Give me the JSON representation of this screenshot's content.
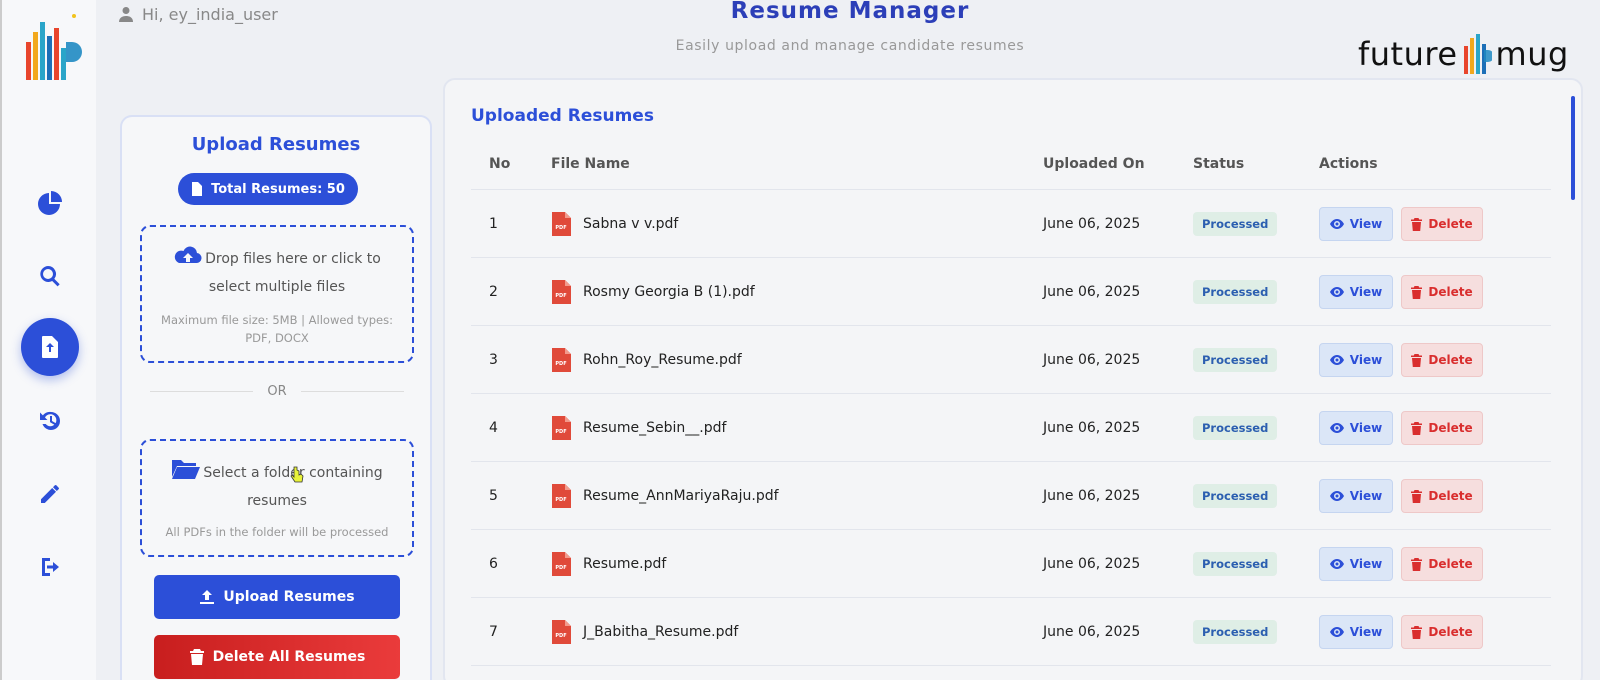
{
  "header": {
    "greeting": "Hi, ey_india_user",
    "title": "Resume Manager",
    "subtitle": "Easily upload and manage candidate resumes",
    "brand_left": "future",
    "brand_right": "mug"
  },
  "sidebar": {
    "items": [
      {
        "name": "dashboard",
        "icon": "pie-chart-icon",
        "active": false
      },
      {
        "name": "search",
        "icon": "search-icon",
        "active": false
      },
      {
        "name": "resumes",
        "icon": "file-upload-icon",
        "active": true
      },
      {
        "name": "history",
        "icon": "history-icon",
        "active": false
      },
      {
        "name": "edit",
        "icon": "pencil-icon",
        "active": false
      },
      {
        "name": "logout",
        "icon": "logout-icon",
        "active": false
      }
    ]
  },
  "upload": {
    "title": "Upload Resumes",
    "total_label": "Total Resumes: 50",
    "drop_text": "Drop files here or click to select multiple files",
    "drop_hint": "Maximum file size: 5MB | Allowed types: PDF, DOCX",
    "or_text": "OR",
    "folder_text": "Select a folder containing resumes",
    "folder_hint": "All PDFs in the folder will be processed",
    "upload_button": "Upload Resumes",
    "delete_all_button": "Delete All Resumes"
  },
  "table": {
    "title": "Uploaded Resumes",
    "columns": {
      "no": "No",
      "file_name": "File Name",
      "uploaded_on": "Uploaded On",
      "status": "Status",
      "actions": "Actions"
    },
    "view_label": "View",
    "delete_label": "Delete",
    "pdf_badge": "PDF",
    "rows": [
      {
        "no": "1",
        "file": "Sabna v v.pdf",
        "date": "June 06, 2025",
        "status": "Processed"
      },
      {
        "no": "2",
        "file": "Rosmy Georgia B (1).pdf",
        "date": "June 06, 2025",
        "status": "Processed"
      },
      {
        "no": "3",
        "file": "Rohn_Roy_Resume.pdf",
        "date": "June 06, 2025",
        "status": "Processed"
      },
      {
        "no": "4",
        "file": "Resume_Sebin__.pdf",
        "date": "June 06, 2025",
        "status": "Processed"
      },
      {
        "no": "5",
        "file": "Resume_AnnMariyaRaju.pdf",
        "date": "June 06, 2025",
        "status": "Processed"
      },
      {
        "no": "6",
        "file": "Resume.pdf",
        "date": "June 06, 2025",
        "status": "Processed"
      },
      {
        "no": "7",
        "file": "J_Babitha_Resume.pdf",
        "date": "June 06, 2025",
        "status": "Processed"
      }
    ]
  },
  "colors": {
    "accent": "#2c4fd8",
    "danger": "#e03131",
    "status_bg": "#dfeee6"
  }
}
